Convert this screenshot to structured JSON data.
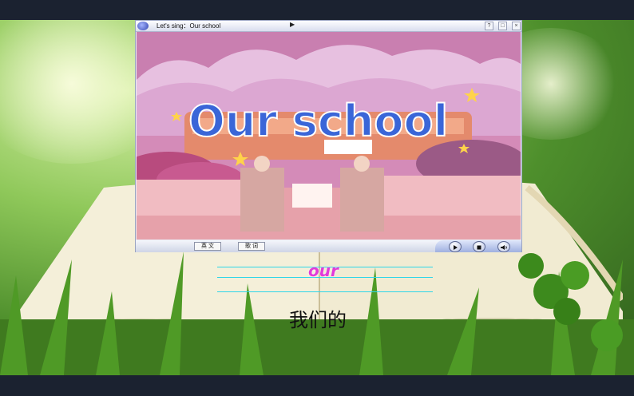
{
  "player": {
    "title": "Let's sing：Our school",
    "window_buttons": [
      "?",
      "□",
      "×"
    ],
    "video_title": "Our school",
    "controls": {
      "english_label": "英 文",
      "lyrics_label": "歌 词"
    },
    "icons": [
      "play-icon",
      "stop-icon",
      "volume-icon"
    ]
  },
  "vocab": {
    "word": "our",
    "meaning": "我们的"
  },
  "colors": {
    "word": "#e23bd9",
    "guide_lines": "#2fd6e8"
  }
}
